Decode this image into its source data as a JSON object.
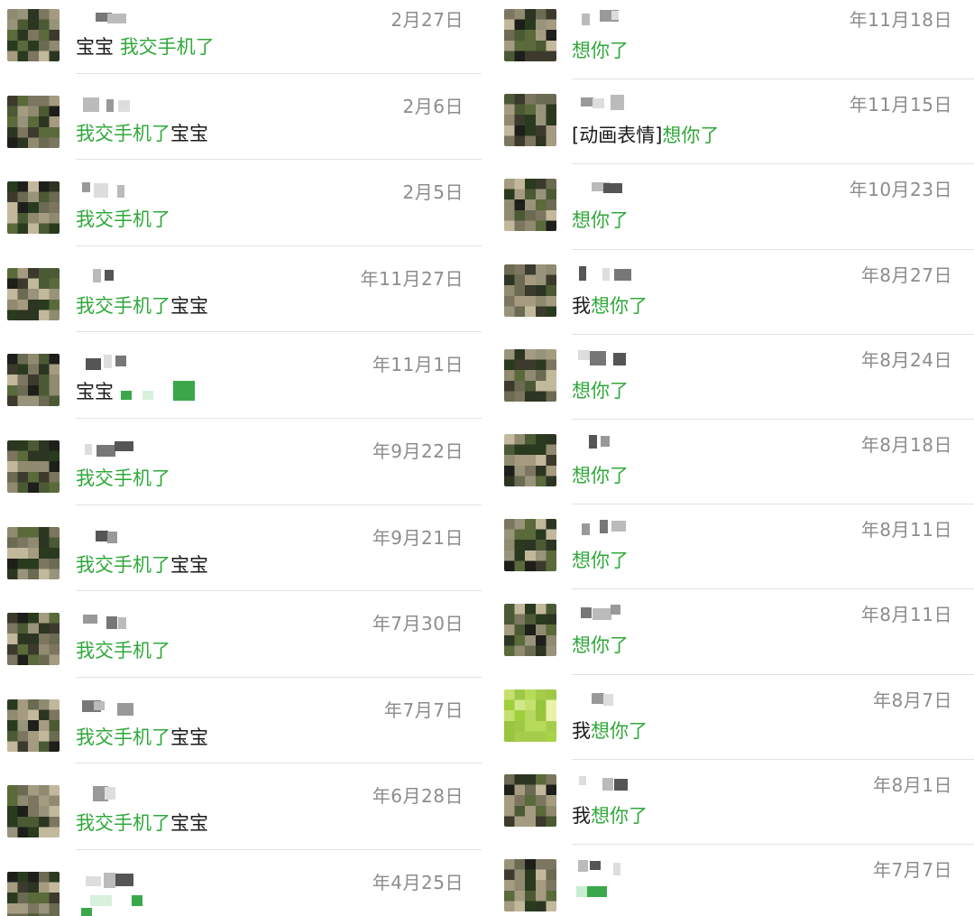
{
  "colors": {
    "accent_green": "#2fa83a",
    "text_dark": "#1a1a1a",
    "date_gray": "#8c8c8c",
    "divider": "#e2e2e2"
  },
  "left": [
    {
      "date": "2月27日",
      "msg_black_prefix": "宝宝 ",
      "msg_green": "我交手机了",
      "msg_black_suffix": ""
    },
    {
      "date": "2月6日",
      "msg_black_prefix": "",
      "msg_green": "我交手机了",
      "msg_black_suffix": "宝宝"
    },
    {
      "date": "2月5日",
      "msg_black_prefix": "",
      "msg_green": "我交手机了",
      "msg_black_suffix": ""
    },
    {
      "date": "年11月27日",
      "msg_black_prefix": "",
      "msg_green": "我交手机了",
      "msg_black_suffix": "宝宝"
    },
    {
      "date": "年11月1日",
      "msg_black_prefix": "宝宝 ",
      "msg_green": "",
      "msg_black_suffix": ""
    },
    {
      "date": "年9月22日",
      "msg_black_prefix": "",
      "msg_green": "我交手机了",
      "msg_black_suffix": ""
    },
    {
      "date": "年9月21日",
      "msg_black_prefix": "",
      "msg_green": "我交手机了",
      "msg_black_suffix": "宝宝"
    },
    {
      "date": "年7月30日",
      "msg_black_prefix": "",
      "msg_green": "我交手机了",
      "msg_black_suffix": ""
    },
    {
      "date": "年7月7日",
      "msg_black_prefix": "",
      "msg_green": "我交手机了",
      "msg_black_suffix": "宝宝"
    },
    {
      "date": "年6月28日",
      "msg_black_prefix": "",
      "msg_green": "我交手机了",
      "msg_black_suffix": "宝宝"
    },
    {
      "date": "年4月25日",
      "msg_black_prefix": "",
      "msg_green": "",
      "msg_black_suffix": ""
    }
  ],
  "right": [
    {
      "date": "年11月18日",
      "msg_black_prefix": "",
      "msg_green": "想你了",
      "msg_black_suffix": ""
    },
    {
      "date": "年11月15日",
      "msg_black_prefix": "[动画表情]",
      "msg_green": "想你了",
      "msg_black_suffix": ""
    },
    {
      "date": "年10月23日",
      "msg_black_prefix": "",
      "msg_green": "想你了",
      "msg_black_suffix": ""
    },
    {
      "date": "年8月27日",
      "msg_black_prefix": "我",
      "msg_green": "想你了",
      "msg_black_suffix": ""
    },
    {
      "date": "年8月24日",
      "msg_black_prefix": "",
      "msg_green": "想你了",
      "msg_black_suffix": ""
    },
    {
      "date": "年8月18日",
      "msg_black_prefix": "",
      "msg_green": "想你了",
      "msg_black_suffix": ""
    },
    {
      "date": "年8月11日",
      "msg_black_prefix": "",
      "msg_green": "想你了",
      "msg_black_suffix": ""
    },
    {
      "date": "年8月11日",
      "msg_black_prefix": "",
      "msg_green": "想你了",
      "msg_black_suffix": ""
    },
    {
      "date": "年8月7日",
      "msg_black_prefix": "我",
      "msg_green": "想你了",
      "msg_black_suffix": ""
    },
    {
      "date": "年8月1日",
      "msg_black_prefix": "我",
      "msg_green": "想你了",
      "msg_black_suffix": ""
    },
    {
      "date": "年7月7日",
      "msg_black_prefix": "",
      "msg_green": "",
      "msg_black_suffix": ""
    }
  ]
}
